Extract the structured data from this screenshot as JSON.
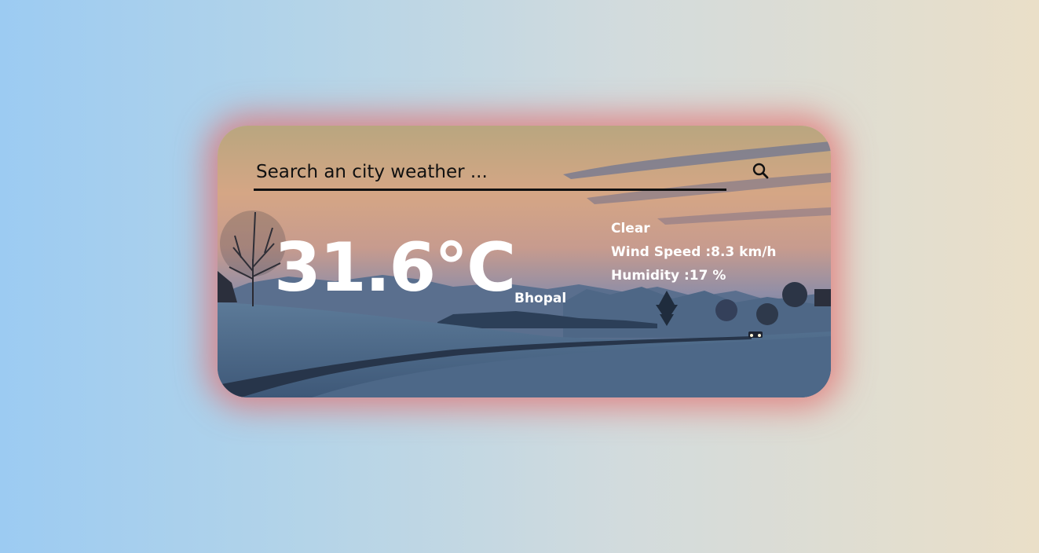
{
  "search": {
    "placeholder": "Search an city weather ...",
    "value": ""
  },
  "weather": {
    "temperature": "31.6°C",
    "city": "Bhopal",
    "condition": "Clear",
    "wind_label": "Wind Speed :",
    "wind_value": "8.3 km/h",
    "humidity_label": "Humidity :",
    "humidity_value": "17 %"
  },
  "icons": {
    "search": "search-icon"
  },
  "colors": {
    "card_glow": "#e26e6e",
    "text": "#ffffff",
    "search_text": "#111111"
  }
}
